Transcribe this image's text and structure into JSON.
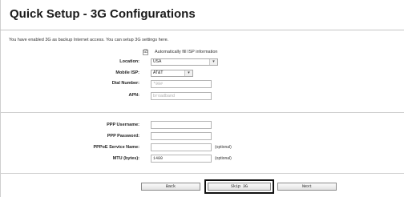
{
  "page": {
    "title": "Quick Setup - 3G Configurations",
    "intro": "You have enabled 3G as backup Internet access. You can setup 3G settings here."
  },
  "isp": {
    "auto_fill_checked": true,
    "auto_fill_mark": "☑",
    "auto_fill_label": "Automatically fill ISP information",
    "location_label": "Location:",
    "location_value": "USA",
    "mobile_isp_label": "Mobile ISP:",
    "mobile_isp_value": "AT&T",
    "dial_number_label": "Dial Number:",
    "dial_number_value": "*99#",
    "apn_label": "APN:",
    "apn_value": "broadband",
    "dropdown_arrow": "▾"
  },
  "ppp": {
    "username_label": "PPP Username:",
    "username_value": "",
    "password_label": "PPP Password:",
    "password_value": "",
    "service_name_label": "PPPoE Service Name:",
    "service_name_value": "",
    "service_name_hint": "(optional)",
    "mtu_label": "MTU (bytes):",
    "mtu_value": "1480",
    "mtu_hint": "(optional)"
  },
  "buttons": {
    "back": "Back",
    "skip": "Skip 3G",
    "next": "Next"
  }
}
